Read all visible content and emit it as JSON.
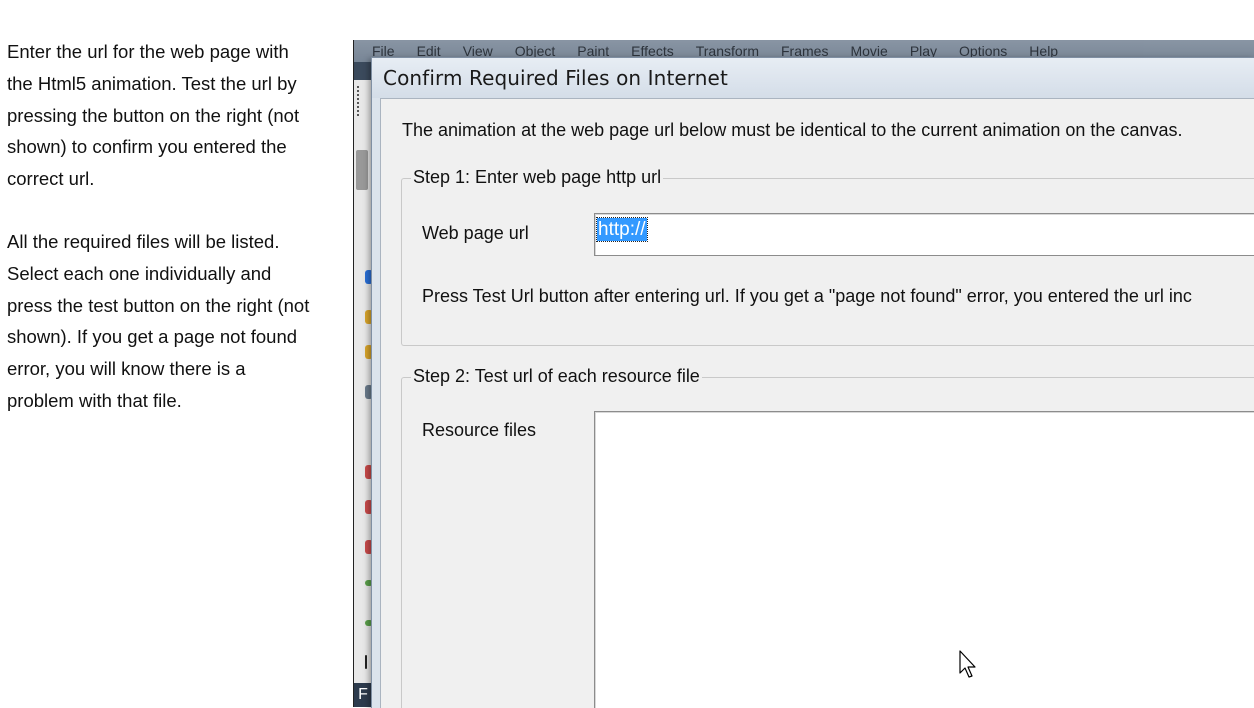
{
  "instructions": {
    "paragraph1": "Enter the url for the web page with\nthe Html5 animation. Test the url by\npressing the button on the right (not\nshown) to confirm you entered the\ncorrect url.",
    "paragraph2": "All the required files will be listed.\nSelect each one individually and\npress the test button on the right (not\nshown). If you get a page not found\nerror, you will know there is a\nproblem with that file."
  },
  "background_app": {
    "menu_items": [
      "File",
      "Edit",
      "View",
      "Object",
      "Paint",
      "Effects",
      "Transform",
      "Frames",
      "Movie",
      "Play",
      "Options",
      "Help"
    ],
    "status_letter": "F"
  },
  "dialog": {
    "title": "Confirm Required Files on Internet",
    "intro": "The animation at the web page url below must be identical to the current animation on the canvas.",
    "step1": {
      "legend": "Step 1: Enter web page http url",
      "url_label": "Web page url",
      "url_value": "http://",
      "hint": "Press Test Url button after entering url. If you get a \"page not found\" error, you entered the url inc"
    },
    "step2": {
      "legend": "Step 2: Test url of each resource file",
      "resource_label": "Resource files",
      "resource_items": []
    }
  }
}
